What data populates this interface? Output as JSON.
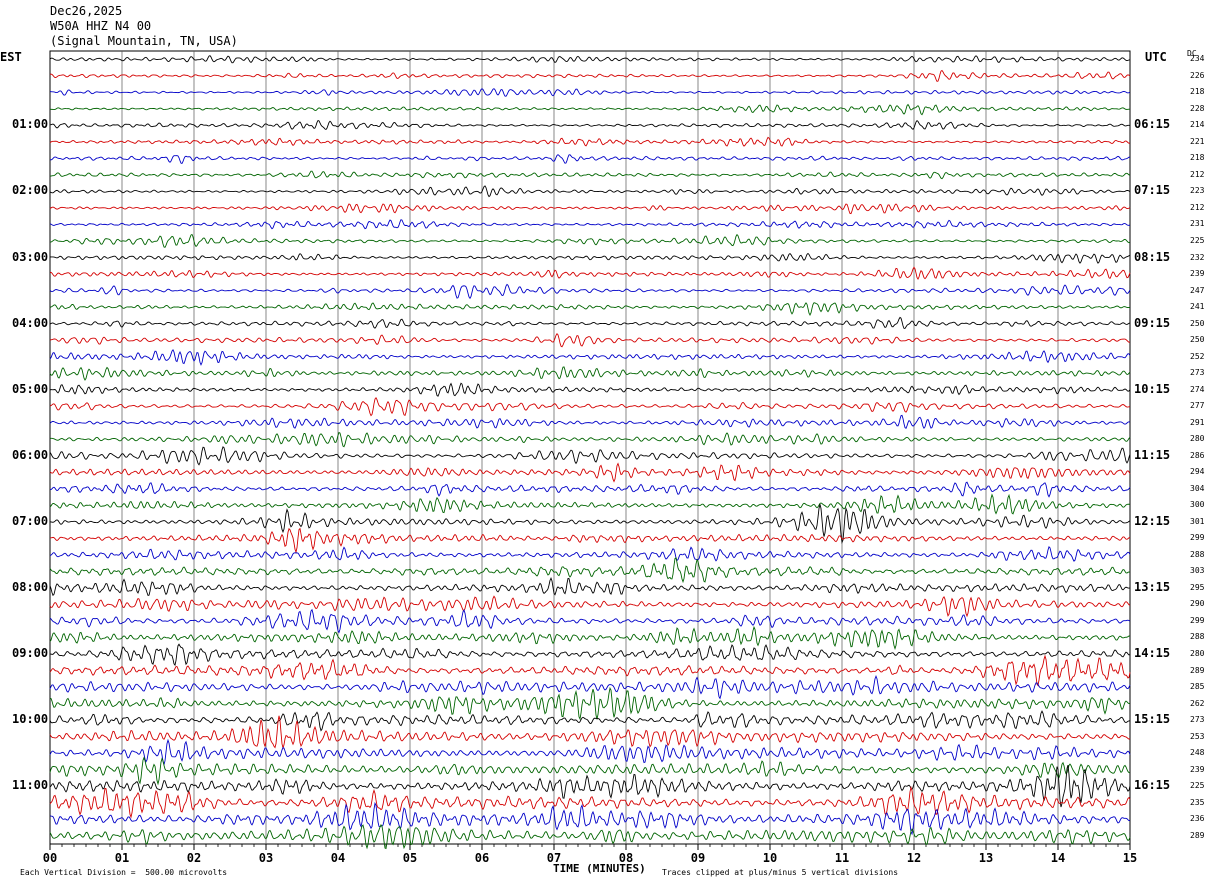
{
  "header": {
    "date": "Dec26,2025",
    "channel": "W50A HHZ N4 00",
    "location": "(Signal Mountain, TN, USA)"
  },
  "left_tz": "EST",
  "right_tz": "UTC",
  "dc_label": "DC",
  "footer": {
    "scale": "Each Vertical Division =  500.00 microvolts",
    "clip": "Traces clipped at plus/minus 5 vertical divisions"
  },
  "chart_data": {
    "type": "line",
    "title": "",
    "xlabel": "TIME (MINUTES)",
    "ylabel": "",
    "x_ticks": [
      "00",
      "01",
      "02",
      "03",
      "04",
      "05",
      "06",
      "07",
      "08",
      "09",
      "10",
      "11",
      "12",
      "13",
      "14",
      "15"
    ],
    "xlim": [
      0,
      15
    ],
    "trace_colors": [
      "#000000",
      "#d40000",
      "#0000c8",
      "#006400"
    ],
    "left_hour_labels": [
      "01:00",
      "02:00",
      "03:00",
      "04:00",
      "05:00",
      "06:00",
      "07:00",
      "08:00",
      "09:00",
      "10:00",
      "11:00"
    ],
    "right_hour_labels": [
      "06:15",
      "07:15",
      "08:15",
      "09:15",
      "10:15",
      "11:15",
      "12:15",
      "13:15",
      "14:15",
      "15:15",
      "16:15"
    ],
    "dc_offsets": [
      234,
      226,
      218,
      228,
      214,
      221,
      218,
      212,
      223,
      212,
      231,
      225,
      232,
      239,
      247,
      241,
      250,
      250,
      252,
      273,
      274,
      277,
      291,
      280,
      286,
      294,
      304,
      300,
      301,
      299,
      288,
      303,
      295,
      290,
      299,
      288,
      280,
      289,
      285,
      262,
      273,
      253,
      248,
      239,
      225,
      235,
      236,
      289
    ],
    "grid": true
  }
}
